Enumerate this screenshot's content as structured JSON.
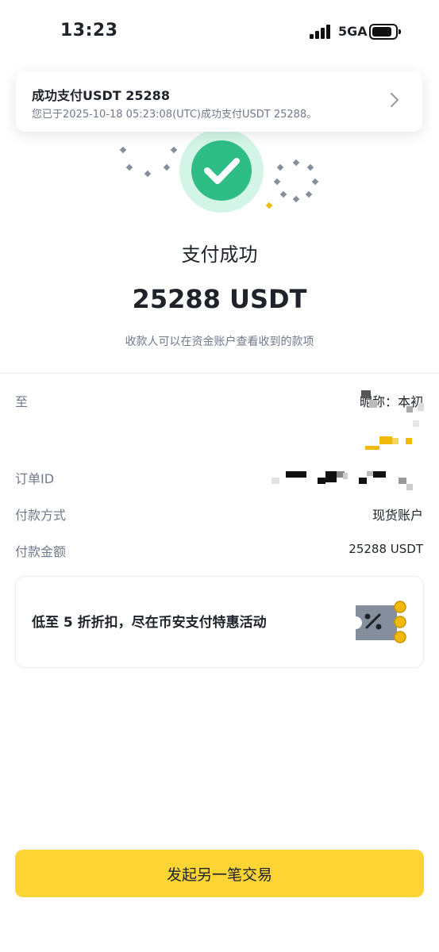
{
  "status_bar": {
    "time": "13:23",
    "network": "5GA"
  },
  "notification": {
    "title": "成功支付USDT 25288",
    "body": "您已于2025-10-18 05:23:08(UTC)成功支付USDT 25288。"
  },
  "result": {
    "title": "支付成功",
    "amount": "25288 USDT",
    "hint": "收款人可以在资金账户查看收到的款项"
  },
  "details": {
    "to_label": "至",
    "to_value": "昵称：本初",
    "order_label": "订单ID",
    "method_label": "付款方式",
    "method_value": "现货账户",
    "amount_label": "付款金额",
    "amount_value": "25288 USDT"
  },
  "promo": {
    "text": "低至 5 折折扣，尽在币安支付特惠活动"
  },
  "cta": {
    "label": "发起另一笔交易"
  },
  "colors": {
    "accent": "#fcd535",
    "success": "#2ebd85",
    "text_primary": "#1e2329",
    "text_secondary": "#707a8a"
  }
}
